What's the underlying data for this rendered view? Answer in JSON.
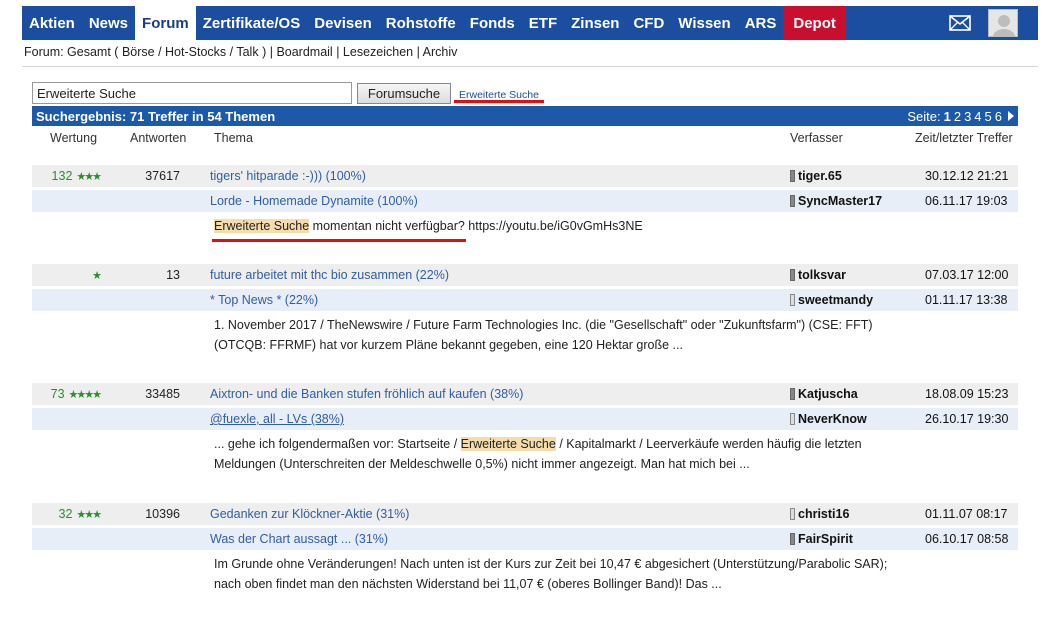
{
  "nav": {
    "items": [
      "Aktien",
      "News",
      "Forum",
      "Zertifikate/OS",
      "Devisen",
      "Rohstoffe",
      "Fonds",
      "ETF",
      "Zinsen",
      "CFD",
      "Wissen",
      "ARS",
      "Depot"
    ],
    "active": "Forum",
    "colors": {
      "bar": "#1c4ea0",
      "depot": "#c8102e"
    }
  },
  "breadcrumb": {
    "prefix": "Forum: Gesamt ( ",
    "link1": "Börse",
    "sep1": " / ",
    "link2": "Hot-Stocks",
    "sep2": " / ",
    "link3": "Talk",
    "mid": " ) | ",
    "link4": "Boardmail",
    "sep3": " | ",
    "link5": "Lesezeichen",
    "sep4": " | ",
    "link6": "Archiv"
  },
  "search": {
    "value": "Erweiterte Suche",
    "button": "Forumsuche",
    "advanced_link": "Erweiterte Suche"
  },
  "results": {
    "title": "Suchergebnis: 71 Treffer in 54 Themen",
    "pager_label": "Seite:",
    "pages": [
      "1",
      "2",
      "3",
      "4",
      "5",
      "6"
    ],
    "current_page": "1"
  },
  "columns": {
    "rating": "Wertung",
    "answers": "Antworten",
    "topic": "Thema",
    "author": "Verfasser",
    "time": "Zeit/letzter Treffer"
  },
  "groups": [
    {
      "rating": "132",
      "stars": "★★★",
      "answers": "37617",
      "thread": "tigers' hitparade :-))) (100%)",
      "thread_author": "tiger.65",
      "thread_time": "30.12.12 21:21",
      "post": "Lorde - Homemade Dynamite (100%)",
      "post_author": "SyncMaster17",
      "post_time": "06.11.17 19:03",
      "snippet_hl": "Erweiterte Suche",
      "snippet_rest": " momentan nicht verfügbar? https://youtu.be/iG0vGmHs3NE"
    },
    {
      "rating": "",
      "stars": "★",
      "answers": "13",
      "thread": "future arbeitet mit thc bio zusammen (22%)",
      "thread_author": "tolksvar",
      "thread_time": "07.03.17 12:00",
      "post": "* Top News * (22%)",
      "post_author": "sweetmandy",
      "post_time": "01.11.17 13:38",
      "snippet_line1": "1. November 2017 / TheNewswire / Future Farm Technologies Inc. (die \"Gesellschaft\" oder \"Zukunftsfarm\") (CSE: FFT)",
      "snippet_line2": "(OTCQB: FFRMF) hat vor kurzem Pläne bekannt gegeben, eine 120 Hektar große ..."
    },
    {
      "rating": "73",
      "stars": "★★★★",
      "answers": "33485",
      "thread": "Aixtron- und die Banken stufen fröhlich auf kaufen (38%)",
      "thread_author": "Katjuscha",
      "thread_time": "18.08.09 15:23",
      "post": "@fuexle, all - LVs (38%)",
      "post_author": "NeverKnow",
      "post_time": "26.10.17 19:30",
      "snippet_pre": "... gehe ich folgendermaßen vor: Startseite / ",
      "snippet_hl": "Erweiterte Suche",
      "snippet_post": " / Kapitalmarkt / Leerverkäufe werden häufig die letzten",
      "snippet_line2": "Meldungen (Unterschreiten der Meldeschwelle 0,5%) nicht immer angezeigt. Man hat mich bei ..."
    },
    {
      "rating": "32",
      "stars": "★★★",
      "answers": "10396",
      "thread": "Gedanken zur Klöckner-Aktie (31%)",
      "thread_author": "christi16",
      "thread_time": "01.11.07 08:17",
      "post": "Was der Chart aussagt ... (31%)",
      "post_author": "FairSpirit",
      "post_time": "06.10.17 08:58",
      "snippet_line1": "Im Grunde ohne Veränderungen! Nach unten ist der Kurs zur Zeit bei 10,47 € abgesichert (Unterstützung/Parabolic SAR);",
      "snippet_line2": "nach oben findet man den nächsten Widerstand bei 11,07 € (oberes Bollinger Band)! Das ..."
    }
  ]
}
